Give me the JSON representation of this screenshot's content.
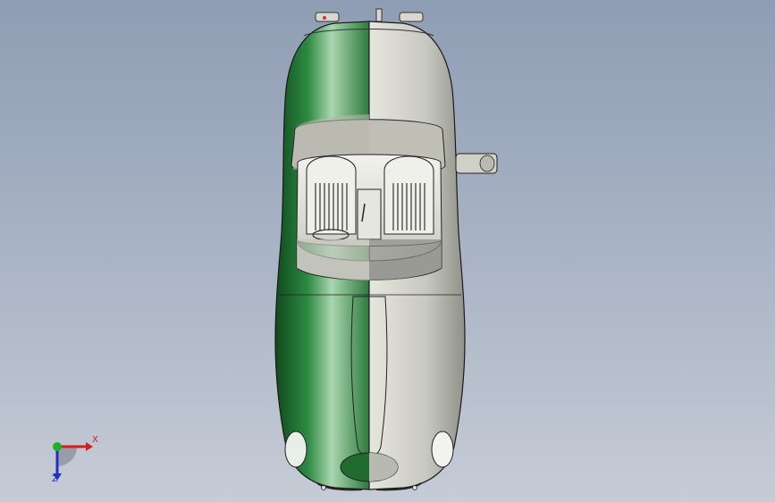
{
  "viewport": {
    "background_top": "#8f9db4",
    "background_bottom": "#c6ccd6"
  },
  "model": {
    "colors": {
      "green_paint": "#1f6a2e",
      "silver_paint": "#c9cac2",
      "interior": "#e8e8e2"
    }
  },
  "triad": {
    "x_label": "X",
    "z_label": "Z",
    "x_color": "#d02020",
    "y_color": "#20b020",
    "z_color": "#2030c0"
  }
}
